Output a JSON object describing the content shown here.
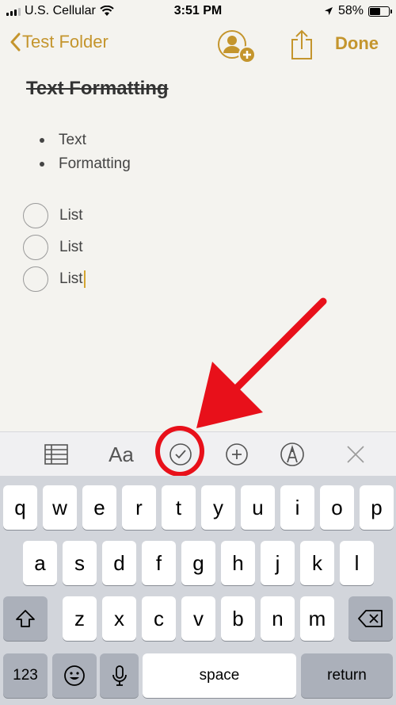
{
  "status_bar": {
    "carrier": "U.S. Cellular",
    "time": "3:51 PM",
    "battery": "58%",
    "battery_level": 0.58
  },
  "nav": {
    "back_label": "Test Folder",
    "done_label": "Done",
    "accent": "#c4952d"
  },
  "note": {
    "title": "Text Formatting",
    "bullets": [
      "Text",
      "Formatting"
    ],
    "checklist": [
      "List",
      "List",
      "List"
    ]
  },
  "toolbar": {
    "icons": [
      "table-icon",
      "text-format-icon",
      "checklist-icon",
      "add-icon",
      "markup-icon",
      "close-icon"
    ],
    "format_label": "Aa",
    "highlight_color": "#e8101a"
  },
  "keyboard": {
    "row1": [
      "q",
      "w",
      "e",
      "r",
      "t",
      "y",
      "u",
      "i",
      "o",
      "p"
    ],
    "row2": [
      "a",
      "s",
      "d",
      "f",
      "g",
      "h",
      "j",
      "k",
      "l"
    ],
    "row3": [
      "z",
      "x",
      "c",
      "v",
      "b",
      "n",
      "m"
    ],
    "numbers_label": "123",
    "space_label": "space",
    "return_label": "return"
  }
}
